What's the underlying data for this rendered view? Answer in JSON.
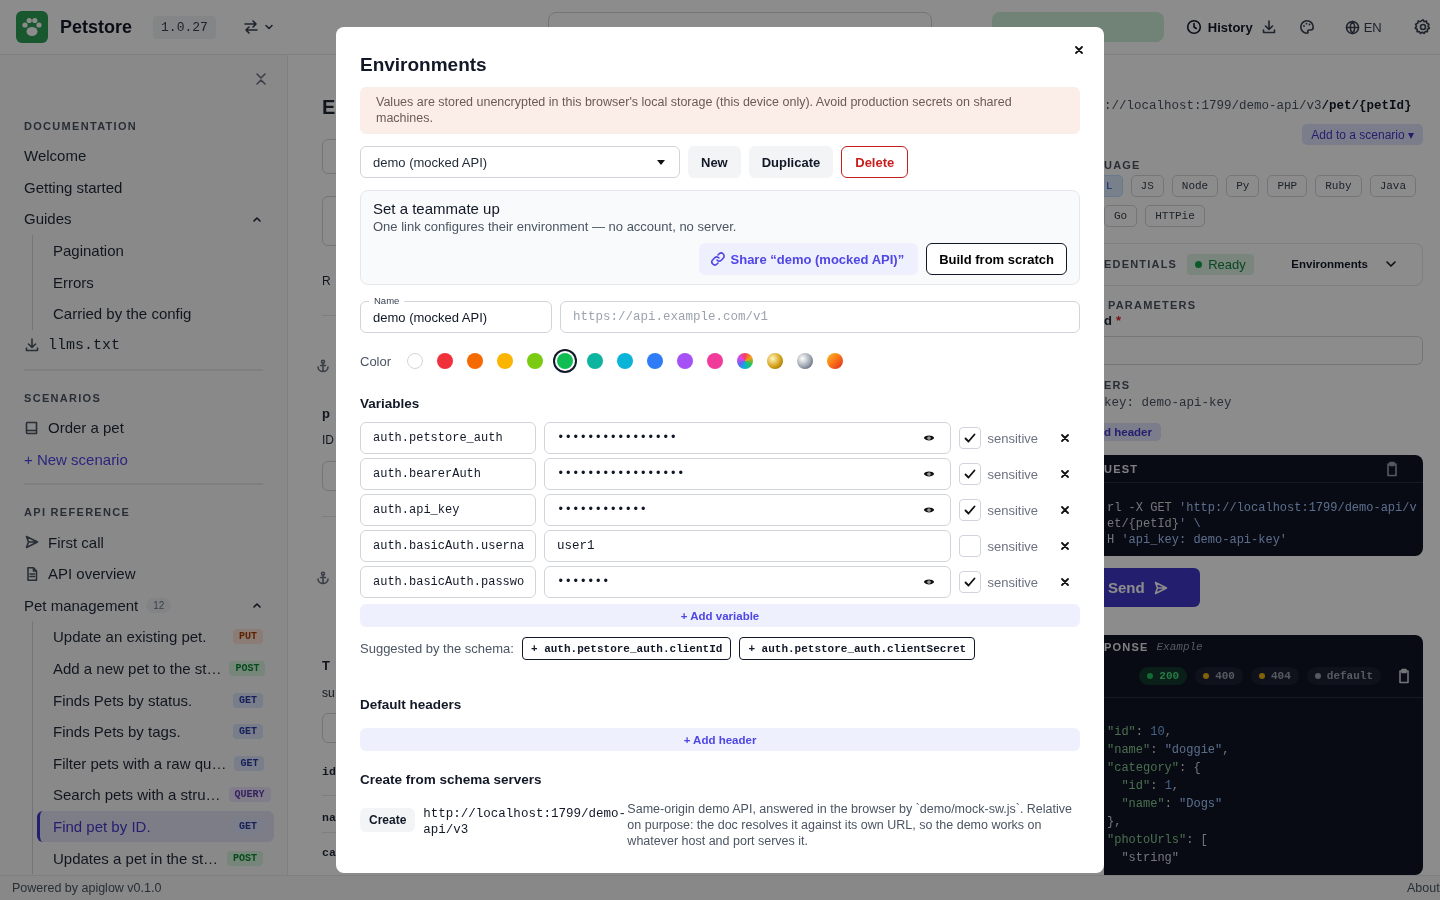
{
  "header": {
    "app_name": "Petstore",
    "version": "1.0.27",
    "history": "History",
    "language": "EN"
  },
  "sidebar": {
    "sections": [
      {
        "title": "DOCUMENTATION",
        "items": [
          {
            "kind": "link",
            "label": "Welcome"
          },
          {
            "kind": "link",
            "label": "Getting started"
          },
          {
            "kind": "group",
            "label": "Guides",
            "expanded": true,
            "children": [
              {
                "kind": "link",
                "label": "Pagination"
              },
              {
                "kind": "link",
                "label": "Errors"
              },
              {
                "kind": "link",
                "label": "Carried by the config"
              }
            ]
          },
          {
            "kind": "download",
            "label": "llms.txt"
          }
        ]
      },
      {
        "title": "SCENARIOS",
        "items": [
          {
            "kind": "scenario",
            "label": "Order a pet"
          },
          {
            "kind": "add",
            "label": "+ New scenario"
          }
        ]
      },
      {
        "title": "API REFERENCE",
        "items": [
          {
            "kind": "call",
            "label": "First call"
          },
          {
            "kind": "overview",
            "label": "API overview"
          },
          {
            "kind": "group",
            "label": "Pet management",
            "count": "12",
            "expanded": true,
            "children": [
              {
                "kind": "endpoint",
                "label": "Update an existing pet.",
                "method": "PUT",
                "color": "#8b7d75",
                "selected": false
              },
              {
                "kind": "endpoint",
                "label": "Add a new pet to the st…",
                "method": "POST",
                "color": "#76877b",
                "selected": false
              },
              {
                "kind": "endpoint",
                "label": "Finds Pets by status.",
                "method": "GET",
                "color": "#7a7d8a",
                "selected": false
              },
              {
                "kind": "endpoint",
                "label": "Finds Pets by tags.",
                "method": "GET",
                "color": "#7a7d8a",
                "selected": false
              },
              {
                "kind": "endpoint",
                "label": "Filter pets with a raw qu…",
                "method": "GET",
                "color": "#7a7d8a",
                "selected": false
              },
              {
                "kind": "endpoint",
                "label": "Search pets with a stru…",
                "method": "QUERY",
                "color": "#827d8b",
                "selected": false
              },
              {
                "kind": "endpoint",
                "label": "Find pet by ID.",
                "method": "GET",
                "color": "#7a7d8a",
                "selected": true
              },
              {
                "kind": "endpoint",
                "label": "Updates a pet in the st…",
                "method": "POST",
                "color": "#76877b",
                "selected": false
              }
            ]
          }
        ]
      }
    ]
  },
  "content_behind": [
    {
      "kind": "title",
      "text": "E"
    },
    {
      "kind": "text",
      "text": "R"
    },
    {
      "kind": "bold",
      "text": "p"
    },
    {
      "kind": "text",
      "text": "ID"
    },
    {
      "kind": "bold",
      "text": "T"
    },
    {
      "kind": "text",
      "text": "su"
    },
    {
      "kind": "mono",
      "text": "id"
    },
    {
      "kind": "mono",
      "text": "na"
    },
    {
      "kind": "mono",
      "text": "ca"
    }
  ],
  "request_panel": {
    "url": "://localhost:1799/demo-api/v3**/pet/{petId}**",
    "add_to_scenario": "Add to a scenario ▾",
    "language_label": "UAGE",
    "languages": [
      {
        "label": "L",
        "selected": true
      },
      {
        "label": "JS",
        "selected": false
      },
      {
        "label": "Node",
        "selected": false
      },
      {
        "label": "Py",
        "selected": false
      },
      {
        "label": "PHP",
        "selected": false
      },
      {
        "label": "Ruby",
        "selected": false
      },
      {
        "label": "Java",
        "selected": false
      },
      {
        "label": "Go",
        "selected": false
      },
      {
        "label": "HTTPie",
        "selected": false
      }
    ],
    "credentials": {
      "label": "EDENTIALS",
      "status": "Ready",
      "environments": "Environments"
    },
    "path_params_label": "PARAMETERS",
    "param": {
      "name": "d",
      "required_mark": "*"
    },
    "headers_label": "ERS",
    "header_line": "key: demo-api-key",
    "add_header": "d header",
    "request": {
      "label": "UEST",
      "lines": [
        "rl -X GET 'http://localhost:1799/demo-api/v",
        "et/{petId}' \\",
        "H 'api_key: demo-api-key'"
      ]
    },
    "send": "Send",
    "response": {
      "label": "PONSE",
      "note": "Example",
      "statuses": [
        {
          "code": "200",
          "color": "#136c34",
          "selected": true
        },
        {
          "code": "400",
          "color": "#816206",
          "selected": false
        },
        {
          "code": "404",
          "color": "#816206",
          "selected": false
        },
        {
          "code": "default",
          "color": "#565a60",
          "selected": false
        }
      ],
      "lines": [
        "\"id\": 10,",
        "\"name\": \"doggie\",",
        "\"category\": {",
        "  \"id\": 1,",
        "  \"name\": \"Dogs\"",
        "},",
        "\"photoUrls\": [",
        "  \"string\""
      ]
    }
  },
  "footer": {
    "powered_by": "Powered by apiglow v0.1.0",
    "about": "About"
  },
  "environments_dialog": {
    "title": "Environments",
    "warning": "Values are stored unencrypted in this browser's local storage (this device only). Avoid production secrets on shared machines.",
    "selected_environment": "demo (mocked API)",
    "actions": [
      {
        "label": "New",
        "kind": "plain"
      },
      {
        "label": "Duplicate",
        "kind": "plain"
      },
      {
        "label": "Delete",
        "kind": "danger"
      }
    ],
    "share_card": {
      "title": "Set a teammate up",
      "description": "One link configures their environment — no account, no server.",
      "share_button": "Share “demo (mocked API)”",
      "scratch_button": "Build from scratch"
    },
    "name_field": {
      "label": "Name",
      "value": "demo (mocked API)"
    },
    "base_url_field": {
      "placeholder": "https://api.example.com/v1"
    },
    "color_label": "Color",
    "colors": [
      {
        "kind": "solid",
        "color": "#ffffff",
        "selected": false
      },
      {
        "kind": "solid",
        "color": "#f0313c",
        "selected": false
      },
      {
        "kind": "solid",
        "color": "#f56a00",
        "selected": false
      },
      {
        "kind": "solid",
        "color": "#fbb400",
        "selected": false
      },
      {
        "kind": "solid",
        "color": "#7acb12",
        "selected": false
      },
      {
        "kind": "solid",
        "color": "#0fbd52",
        "selected": true
      },
      {
        "kind": "solid",
        "color": "#0db5a0",
        "selected": false
      },
      {
        "kind": "solid",
        "color": "#0ab4d8",
        "selected": false
      },
      {
        "kind": "solid",
        "color": "#2f7cf6",
        "selected": false
      },
      {
        "kind": "solid",
        "color": "#a651f5",
        "selected": false
      },
      {
        "kind": "solid",
        "color": "#f13b9b",
        "selected": false
      },
      {
        "kind": "rainbow",
        "selected": false
      },
      {
        "kind": "gold",
        "selected": false
      },
      {
        "kind": "silver",
        "selected": false
      },
      {
        "kind": "sunset",
        "selected": false
      }
    ],
    "variables_title": "Variables",
    "variables": [
      {
        "name": "auth.petstore_auth",
        "value": "••••••••••••••••",
        "sensitive": true,
        "sensitive_label": "sensitive"
      },
      {
        "name": "auth.bearerAuth",
        "value": "•••••••••••••••••",
        "sensitive": true,
        "sensitive_label": "sensitive"
      },
      {
        "name": "auth.api_key",
        "value": "••••••••••••",
        "sensitive": true,
        "sensitive_label": "sensitive"
      },
      {
        "name": "auth.basicAuth.userna",
        "value": "user1",
        "sensitive": false,
        "sensitive_label": "sensitive"
      },
      {
        "name": "auth.basicAuth.passwo",
        "value": "•••••••",
        "sensitive": true,
        "sensitive_label": "sensitive"
      }
    ],
    "add_variable": "+ Add variable",
    "suggested_label": "Suggested by the schema:",
    "suggestions": [
      "+ auth.petstore_auth.clientId",
      "+ auth.petstore_auth.clientSecret"
    ],
    "headers_title": "Default headers",
    "add_header": "+ Add header",
    "servers_title": "Create from schema servers",
    "servers": [
      {
        "button": "Create",
        "url": "http://localhost:1799/demo-api/v3",
        "description": "Same-origin demo API, answered in the browser by `demo/mock-sw.js`. Relative on purpose: the doc resolves it against its own URL, so the demo works on whatever host and port serves it."
      }
    ]
  }
}
